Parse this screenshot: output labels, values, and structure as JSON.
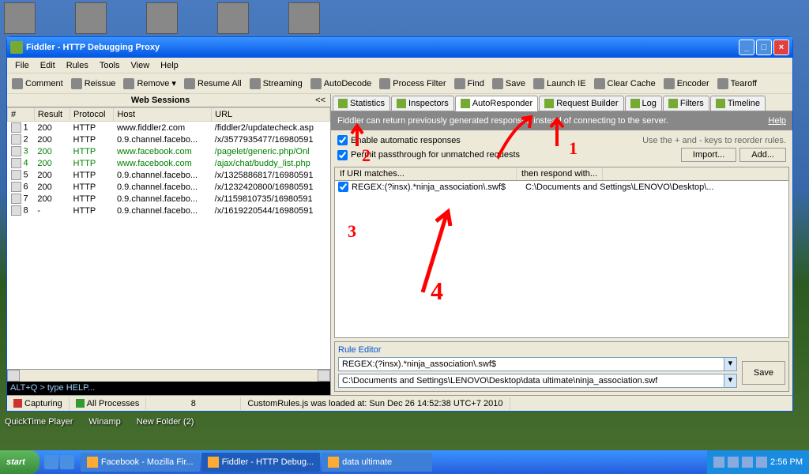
{
  "desktop": {
    "labels": [
      "QuickTime Player",
      "Winamp",
      "New Folder (2)"
    ]
  },
  "window": {
    "title": "Fiddler - HTTP Debugging Proxy",
    "menu": [
      "File",
      "Edit",
      "Rules",
      "Tools",
      "View",
      "Help"
    ],
    "toolbar": [
      {
        "label": "Comment"
      },
      {
        "label": "Reissue"
      },
      {
        "label": "Remove"
      },
      {
        "label": "Resume All"
      },
      {
        "label": "Streaming"
      },
      {
        "label": "AutoDecode"
      },
      {
        "label": "Process Filter"
      },
      {
        "label": "Find"
      },
      {
        "label": "Save"
      },
      {
        "label": "Launch IE"
      },
      {
        "label": "Clear Cache"
      },
      {
        "label": "Encoder"
      },
      {
        "label": "Tearoff"
      }
    ]
  },
  "sessions": {
    "title": "Web Sessions",
    "cols": [
      "#",
      "Result",
      "Protocol",
      "Host",
      "URL"
    ],
    "rows": [
      {
        "n": "1",
        "r": "200",
        "p": "HTTP",
        "h": "www.fiddler2.com",
        "u": "/fiddler2/updatecheck.asp",
        "g": false
      },
      {
        "n": "2",
        "r": "200",
        "p": "HTTP",
        "h": "0.9.channel.facebo...",
        "u": "/x/3577935477/16980591",
        "g": false
      },
      {
        "n": "3",
        "r": "200",
        "p": "HTTP",
        "h": "www.facebook.com",
        "u": "/pagelet/generic.php/Onl",
        "g": true
      },
      {
        "n": "4",
        "r": "200",
        "p": "HTTP",
        "h": "www.facebook.com",
        "u": "/ajax/chat/buddy_list.php",
        "g": true
      },
      {
        "n": "5",
        "r": "200",
        "p": "HTTP",
        "h": "0.9.channel.facebo...",
        "u": "/x/1325886817/16980591",
        "g": false
      },
      {
        "n": "6",
        "r": "200",
        "p": "HTTP",
        "h": "0.9.channel.facebo...",
        "u": "/x/1232420800/16980591",
        "g": false
      },
      {
        "n": "7",
        "r": "200",
        "p": "HTTP",
        "h": "0.9.channel.facebo...",
        "u": "/x/1159810735/16980591",
        "g": false
      },
      {
        "n": "8",
        "r": "-",
        "p": "HTTP",
        "h": "0.9.channel.facebo...",
        "u": "/x/1619220544/16980591",
        "g": false
      }
    ]
  },
  "cmdline": "ALT+Q > type HELP...",
  "tabs": [
    "Statistics",
    "Inspectors",
    "AutoResponder",
    "Request Builder",
    "Log",
    "Filters",
    "Timeline"
  ],
  "ar": {
    "desc": "Fiddler can return previously generated responses instead of connecting to the server.",
    "help": "Help",
    "opt1": "Enable automatic responses",
    "opt2": "Permit passthrough for unmatched requests",
    "hint": "Use the + and - keys to reorder rules.",
    "import": "Import...",
    "add": "Add...",
    "head1": "If URI matches...",
    "head2": "then respond with...",
    "rule_match": "REGEX:(?insx).*ninja_association\\.swf$",
    "rule_resp": "C:\\Documents and Settings\\LENOVO\\Desktop\\..."
  },
  "editor": {
    "legend": "Rule Editor",
    "v1": "REGEX:(?insx).*ninja_association\\.swf$",
    "v2": "C:\\Documents and Settings\\LENOVO\\Desktop\\data ultimate\\ninja_association.swf",
    "save": "Save"
  },
  "status": {
    "capturing": "Capturing",
    "processes": "All Processes",
    "count": "8",
    "msg": "CustomRules.js was loaded at: Sun Dec 26 14:52:38 UTC+7 2010"
  },
  "taskbar": {
    "start": "start",
    "tasks": [
      "Facebook - Mozilla Fir...",
      "Fiddler - HTTP Debug...",
      "data ultimate"
    ],
    "time": "2:56 PM"
  },
  "annotations": {
    "a1": "1",
    "a2": "2",
    "a3": "3",
    "a4": "4"
  }
}
